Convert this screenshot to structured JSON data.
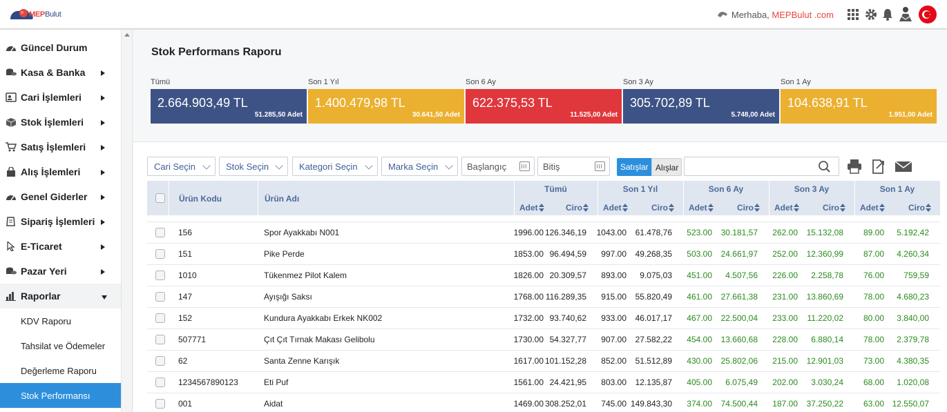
{
  "header": {
    "logo_brand": "MEP",
    "logo_suffix": "Bulut",
    "greeting": "Merhaba,",
    "user": "MEPBulut .com",
    "icons": [
      "handshake-icon",
      "apps-grid-icon",
      "gear-icon",
      "bell-icon",
      "user-silhouette-icon",
      "turkey-flag-icon"
    ]
  },
  "sidebar": {
    "items": [
      {
        "label": "Güncel Durum",
        "icon": "gauge-icon",
        "caret": false
      },
      {
        "label": "Kasa & Banka",
        "icon": "coins-icon",
        "caret": true
      },
      {
        "label": "Cari İşlemleri",
        "icon": "contact-card-icon",
        "caret": true
      },
      {
        "label": "Stok İşlemleri",
        "icon": "box-icon",
        "caret": true
      },
      {
        "label": "Satış İşlemleri",
        "icon": "cart-icon",
        "caret": true
      },
      {
        "label": "Alış İşlemleri",
        "icon": "shopping-bag-icon",
        "caret": true
      },
      {
        "label": "Genel Giderler",
        "icon": "gauge-icon",
        "caret": true
      },
      {
        "label": "Sipariş İşlemleri",
        "icon": "document-icon",
        "caret": true
      },
      {
        "label": "E-Ticaret",
        "icon": "cursor-icon",
        "caret": true
      },
      {
        "label": "Pazar Yeri",
        "icon": "coins-icon",
        "caret": true
      },
      {
        "label": "Raporlar",
        "icon": "bar-chart-icon",
        "caret": true,
        "open": true
      }
    ],
    "subitems": [
      {
        "label": "KDV Raporu"
      },
      {
        "label": "Tahsilat ve Ödemeler"
      },
      {
        "label": "Değerleme Raporu"
      },
      {
        "label": "Stok Performansı",
        "active": true
      }
    ]
  },
  "page": {
    "title": "Stok Performans Raporu"
  },
  "summary": [
    {
      "caption": "Tümü",
      "amount": "2.664.903,49 TL",
      "qty": "51.285,50 Adet",
      "color": "#3e5385"
    },
    {
      "caption": "Son 1 Yıl",
      "amount": "1.400.479,98 TL",
      "qty": "30.641,50 Adet",
      "color": "#ebb02f"
    },
    {
      "caption": "Son 6 Ay",
      "amount": "622.375,53 TL",
      "qty": "11.525,00 Adet",
      "color": "#e0373d"
    },
    {
      "caption": "Son 3 Ay",
      "amount": "305.702,89 TL",
      "qty": "5.748,00 Adet",
      "color": "#3e5385"
    },
    {
      "caption": "Son 1 Ay",
      "amount": "104.638,91 TL",
      "qty": "1.951,00 Adet",
      "color": "#ebb02f"
    }
  ],
  "filters": {
    "cari": "Cari Seçin",
    "stok": "Stok Seçin",
    "kategori": "Kategori Seçin",
    "marka": "Marka Seçin",
    "start_placeholder": "Başlangıç",
    "end_placeholder": "Bitiş",
    "sales_label": "Satışlar",
    "purchases_label": "Alışlar",
    "search_value": ""
  },
  "table": {
    "col_code": "Ürün Kodu",
    "col_name": "Ürün Adı",
    "groups": [
      "Tümü",
      "Son 1 Yıl",
      "Son 6 Ay",
      "Son 3 Ay",
      "Son 1 Ay"
    ],
    "sub_qty": "Adet",
    "sub_rev": "Ciro",
    "rows": [
      {
        "code": "156",
        "name": "Spor Ayakkabı N001",
        "v": [
          "1996.00",
          "126.346,19",
          "1043.00",
          "61.478,76",
          "523.00",
          "30.181,57",
          "262.00",
          "15.132,08",
          "89.00",
          "5.192,42"
        ]
      },
      {
        "code": "151",
        "name": "Pike Perde",
        "v": [
          "1853.00",
          "96.494,59",
          "997.00",
          "49.268,35",
          "503.00",
          "24.661,97",
          "252.00",
          "12.360,99",
          "87.00",
          "4.260,34"
        ]
      },
      {
        "code": "1010",
        "name": "Tükenmez Pilot Kalem",
        "v": [
          "1826.00",
          "20.309,57",
          "893.00",
          "9.075,03",
          "451.00",
          "4.507,56",
          "226.00",
          "2.258,78",
          "76.00",
          "759,59"
        ]
      },
      {
        "code": "147",
        "name": "Ayışığı Saksı",
        "v": [
          "1768.00",
          "116.289,35",
          "915.00",
          "55.820,49",
          "461.00",
          "27.661,38",
          "231.00",
          "13.860,69",
          "78.00",
          "4.680,23"
        ]
      },
      {
        "code": "152",
        "name": "Kundura Ayakkabı Erkek NK002",
        "v": [
          "1732.00",
          "93.740,62",
          "933.00",
          "46.017,17",
          "467.00",
          "22.500,04",
          "233.00",
          "11.220,02",
          "80.00",
          "3.840,00"
        ]
      },
      {
        "code": "507771",
        "name": "Çıt Çıt Tırnak Makası Gelibolu",
        "v": [
          "1730.00",
          "54.327,77",
          "907.00",
          "27.582,22",
          "454.00",
          "13.660,68",
          "228.00",
          "6.880,14",
          "78.00",
          "2.379,78"
        ]
      },
      {
        "code": "62",
        "name": "Santa Zenne Karışık",
        "v": [
          "1617.00",
          "101.152,28",
          "852.00",
          "51.512,89",
          "430.00",
          "25.802,06",
          "215.00",
          "12.901,03",
          "73.00",
          "4.380,35"
        ]
      },
      {
        "code": "1234567890123",
        "name": "Eti Puf",
        "v": [
          "1561.00",
          "24.421,95",
          "803.00",
          "12.135,87",
          "405.00",
          "6.075,49",
          "202.00",
          "3.030,24",
          "68.00",
          "1.020,08"
        ]
      },
      {
        "code": "001",
        "name": "Aidat",
        "v": [
          "1469.00",
          "308.252,01",
          "745.00",
          "149.843,30",
          "374.00",
          "74.500,44",
          "187.00",
          "37.250,22",
          "63.00",
          "12.550,07"
        ]
      }
    ]
  },
  "colors": {
    "accent": "#2d8fdc",
    "green": "#2a8a1e",
    "header_text": "#4a6a9a"
  }
}
